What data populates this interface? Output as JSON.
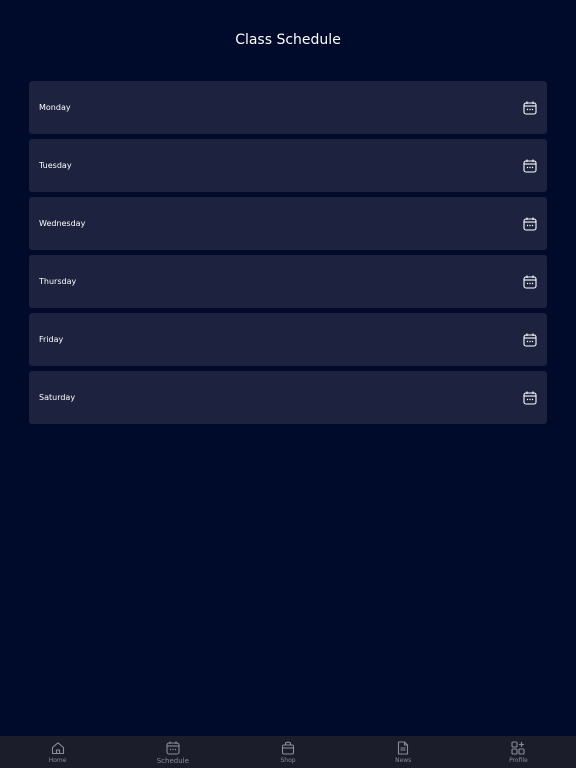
{
  "header": {
    "title": "Class Schedule"
  },
  "days": [
    {
      "label": "Monday",
      "icon": "calendar-icon"
    },
    {
      "label": "Tuesday",
      "icon": "calendar-icon"
    },
    {
      "label": "Wednesday",
      "icon": "calendar-icon"
    },
    {
      "label": "Thursday",
      "icon": "calendar-icon"
    },
    {
      "label": "Friday",
      "icon": "calendar-icon"
    },
    {
      "label": "Saturday",
      "icon": "calendar-icon"
    }
  ],
  "tabs": [
    {
      "label": "Home",
      "icon": "home-icon"
    },
    {
      "label": "Schedule",
      "icon": "calendar-icon",
      "active": true
    },
    {
      "label": "Shop",
      "icon": "shopping-bag-icon"
    },
    {
      "label": "News",
      "icon": "document-icon"
    },
    {
      "label": "Profile",
      "icon": "grid-plus-icon"
    }
  ],
  "colors": {
    "background": "#000a2a",
    "card": "#1d233e",
    "tab_bar": "#1b1e2a",
    "tab_text": "#8a8d99"
  }
}
